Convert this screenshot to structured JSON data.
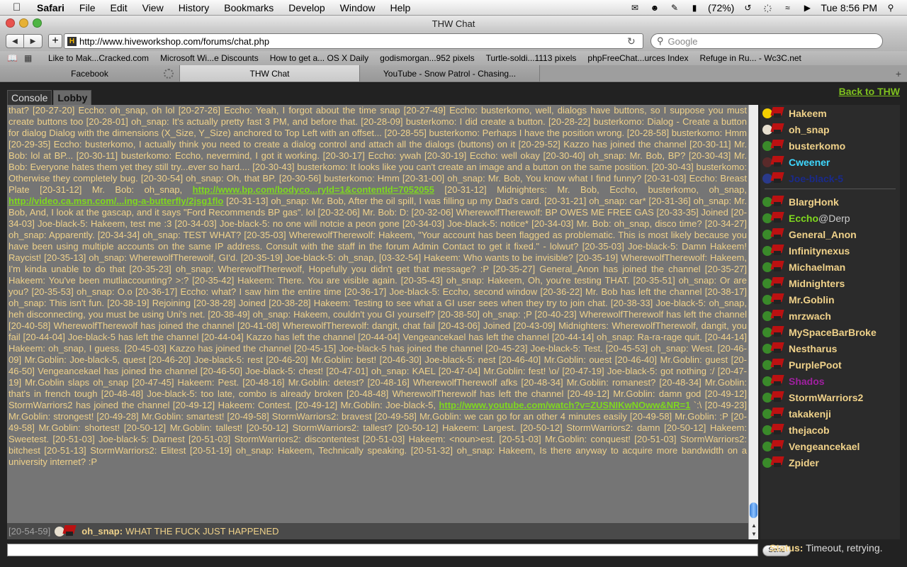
{
  "menubar": {
    "app": "Safari",
    "items": [
      "File",
      "Edit",
      "View",
      "History",
      "Bookmarks",
      "Develop",
      "Window",
      "Help"
    ],
    "battery": "(72%)",
    "clock": "Tue 8:56 PM"
  },
  "window": {
    "title": "THW Chat"
  },
  "toolbar": {
    "url": "http://www.hiveworkshop.com/forums/chat.php",
    "search_placeholder": "Google"
  },
  "bookmarks": [
    "Like to Mak...Cracked.com",
    "Microsoft Wi...e Discounts",
    "How to get a... OS X Daily",
    "godismorgan...952 pixels",
    "Turtle-soldi...1113 pixels",
    "phpFreeChat...urces Index",
    "Refuge in Ru... - Wc3C.net"
  ],
  "tabs": [
    {
      "label": "Facebook",
      "loading": true
    },
    {
      "label": "THW Chat",
      "active": true
    },
    {
      "label": "YouTube - Snow Patrol - Chasing..."
    }
  ],
  "chat": {
    "tab_console": "Console",
    "tab_lobby": "Lobby",
    "back_link": "Back to THW",
    "messages_before_link1": "that? [20-27-20] Eccho: oh_snap, oh lol [20-27-26] Eccho: Yeah, I forgot about the time snap [20-27-49] Eccho: busterkomo, well, dialogs have buttons, so I suppose you must create buttons too [20-28-01] oh_snap: It's actually pretty fast 3 PM, and before that. [20-28-09] busterkomo: I did create a button. [20-28-22] busterkomo: Dialog - Create a button for dialog Dialog with the dimensions (X_Size, Y_Size) anchored to Top Left with an offset... [20-28-55] busterkomo: Perhaps I have the position wrong. [20-28-58] busterkomo: Hmm [20-29-35] Eccho: busterkomo, I actually think you need to create a dialog control and attach all the dialogs (buttons) on it [20-29-52] Kazzo has joined the channel [20-30-11] Mr. Bob: lol at BP... [20-30-11] busterkomo: Eccho, nevermind, I got it working. [20-30-17] Eccho: ywah [20-30-19] Eccho: well okay [20-30-40] oh_snap: Mr. Bob, BP? [20-30-43] Mr. Bob: Everyone hates them yet they still try...ever so hard.... [20-30-43] busterkomo: It looks like you can't create an image and a button on the same position. [20-30-43] busterkomo: Otherwise they completely bug. [20-30-54] oh_snap: Oh, that BP. [20-30-56] busterkomo: Hmm [20-31-00] oh_snap: Mr. Bob, You know what I find funny? [20-31-03] Eccho: Breast Plate [20-31-12] Mr. Bob: oh_snap,",
    "link1": "http://www.bp.com/bodyco...ryId=1&contentId=7052055",
    "messages_between_links": "[20-31-12] Midnighters: Mr. Bob, Eccho, busterkomo, oh_snap,",
    "link2": "http://video.ca.msn.com/...ing-a-butterfly/2jsg1flo",
    "messages_before_link3": "[20-31-13] oh_snap: Mr. Bob, After the oil spill, I was filling up my Dad's card. [20-31-21] oh_snap: car* [20-31-36] oh_snap: Mr. Bob, And, I look at the gascap, and it says \"Ford Recommends BP gas\". lol [20-32-06] Mr. Bob: D: [20-32-06] WherewolfTherewolf: BP OWES ME FREE GAS [20-33-35] Joined [20-34-03] Joe-black-5: Hakeem, test me :3 [20-34-03] Joe-black-5: no one will notcie a peon gone [20-34-03] Joe-black-5: notice* [20-34-03] Mr. Bob: oh_snap, disco time? [20-34-27] oh_snap: Apparently. [20-34-34] oh_snap: TEST WHAT? [20-35-03] WherewolfTherewolf: Hakeem, \"Your account has been flagged as problematic. This is most likely because you have been using multiple accounts on the same IP address. Consult with the staff in the forum Admin Contact to get it fixed.\" - lolwut? [20-35-03] Joe-black-5: Damn Hakeem! Raycist! [20-35-13] oh_snap: WherewolfTherewolf, GI'd. [20-35-19] Joe-black-5: oh_snap, [03-32-54] Hakeem: Who wants to be invisible? [20-35-19] WherewolfTherewolf: Hakeem, I'm kinda unable to do that [20-35-23] oh_snap: WherewolfTherewolf, Hopefully you didn't get that message? :P [20-35-27] General_Anon has joined the channel [20-35-27] Hakeem: You've been mutliaccounting? >:? [20-35-42] Hakeem: There. You are visible again. [20-35-43] oh_snap: Hakeem, Oh, you're testing THAT. [20-35-51] oh_snap: Or are you? [20-35-53] oh_snap: O.o [20-36-17] Eccho: what? I saw him the entire time [20-36-17] Joe-black-5: Eccho, second window [20-36-22] Mr. Bob has left the channel [20-38-17] oh_snap: This isn't fun. [20-38-19] Rejoining [20-38-28] Joined [20-38-28] Hakeem: Testing to see what a GI user sees when they try to join chat. [20-38-33] Joe-black-5: oh_snap, heh disconnecting, you must be using Uni's net. [20-38-49] oh_snap: Hakeem, couldn't you GI yourself? [20-38-50] oh_snap: ;P [20-40-23] WherewolfTherewolf has left the channel [20-40-58] WherewolfTherewolf has joined the channel [20-41-08] WherewolfTherewolf: dangit, chat fail [20-43-06] Joined [20-43-09] Midnighters: WherewolfTherewolf, dangit, you fail [20-44-04] Joe-black-5 has left the channel [20-44-04] Kazzo has left the channel [20-44-04] Vengeancekael has left the channel [20-44-14] oh_snap: Ra-ra-rage quit. [20-44-14] Hakeem: oh_snap, I guess. [20-45-03] Kazzo has joined the channel [20-45-15] Joe-black-5 has joined the channel [20-45-23] Joe-black-5: Test. [20-45-53] oh_snap: West. [20-46-09] Mr.Goblin: Joe-black-5, quest [20-46-20] Joe-black-5: rest [20-46-20] Mr.Goblin: best! [20-46-30] Joe-black-5: nest [20-46-40] Mr.Goblin: ouest [20-46-40] Mr.Goblin: guest [20-46-50] Vengeancekael has joined the channel [20-46-50] Joe-black-5: chest! [20-47-01] oh_snap: KAEL [20-47-04] Mr.Goblin: fest! \\o/ [20-47-19] Joe-black-5: got nothing :/ [20-47-19] Mr.Goblin slaps oh_snap [20-47-45] Hakeem: Pest. [20-48-16] Mr.Goblin: detest? [20-48-16] WherewolfTherewolf afks [20-48-34] Mr.Goblin: romanest? [20-48-34] Mr.Goblin: that's in french tough [20-48-48] Joe-black-5: too late, combo is already broken [20-48-48] WherewolfTherewolf has left the channel [20-49-12] Mr.Goblin: damn god [20-49-12] StormWarriors2 has joined the channel [20-49-12] Hakeem: Contest. [20-49-12] Mr.Goblin: Joe-black-5,",
    "link3": "http://www.youtube.com/watch?v=ZUSNIKwNOww&NR=1",
    "messages_after_link3": "`:\\ [20-49-23] Mr.Goblin: strongest! [20-49-28] Mr.Goblin: smartest! [20-49-58] StormWarriors2: bravest [20-49-58] Mr.Goblin: we can go for an other 4 minutes easily [20-49-58] Mr.Goblin: :P [20-49-58] Mr.Goblin: shortest! [20-50-12] Mr.Goblin: tallest! [20-50-12] StormWarriors2: tallest? [20-50-12] Hakeem: Largest. [20-50-12] StormWarriors2: damn [20-50-12] Hakeem: Sweetest. [20-51-03] Joe-black-5: Darnest [20-51-03] StormWarriors2: discontentest [20-51-03] Hakeem: <noun>est. [20-51-03] Mr.Goblin: conquest! [20-51-03] StormWarriors2: bitchest [20-51-13] StormWarriors2: Elitest [20-51-19] oh_snap: Hakeem, Technically speaking. [20-51-32] oh_snap: Hakeem, Is there anyway to acquire more bandwidth on a university internet? :P",
    "last_message": {
      "timestamp": "[20-54-59]",
      "nick": "oh_snap:",
      "text": "WHAT THE FUCK JUST HAPPENED"
    },
    "send_label": "Send",
    "status_label": "Status:",
    "status_text": "Timeout, retrying."
  },
  "users": {
    "moderators": [
      {
        "name": "Hakeem",
        "color": "#f0d28a",
        "avatar": "smiley"
      },
      {
        "name": "oh_snap",
        "color": "#f0d28a",
        "avatar": "skull"
      },
      {
        "name": "busterkomo",
        "color": "#f0d28a",
        "avatar": "orc"
      },
      {
        "name": "Cweener",
        "color": "#3fd8ff",
        "avatar": "orc-red"
      },
      {
        "name": "Joe-black-5",
        "color": "#1a2a8a",
        "avatar": "orc-blue"
      }
    ],
    "members": [
      {
        "name": "BlargHonk",
        "color": "#f0d28a"
      },
      {
        "name": "Eccho",
        "suffix": "@Derp",
        "color": "#7fd81e"
      },
      {
        "name": "General_Anon",
        "color": "#f0d28a"
      },
      {
        "name": "Infinitynexus",
        "color": "#f0d28a"
      },
      {
        "name": "Michaelman",
        "color": "#f0d28a"
      },
      {
        "name": "Midnighters",
        "color": "#f0d28a"
      },
      {
        "name": "Mr.Goblin",
        "color": "#f0d28a"
      },
      {
        "name": "mrzwach",
        "color": "#f0d28a"
      },
      {
        "name": "MySpaceBarBroke",
        "color": "#f0d28a"
      },
      {
        "name": "Nestharus",
        "color": "#f0d28a"
      },
      {
        "name": "PurplePoot",
        "color": "#f0d28a"
      },
      {
        "name": "Shados",
        "color": "#a020a0"
      },
      {
        "name": "StormWarriors2",
        "color": "#f0d28a"
      },
      {
        "name": "takakenji",
        "color": "#f0d28a"
      },
      {
        "name": "thejacob",
        "color": "#f0d28a"
      },
      {
        "name": "Vengeancekael",
        "color": "#f0d28a"
      },
      {
        "name": "Zpider",
        "color": "#f0d28a"
      }
    ]
  }
}
